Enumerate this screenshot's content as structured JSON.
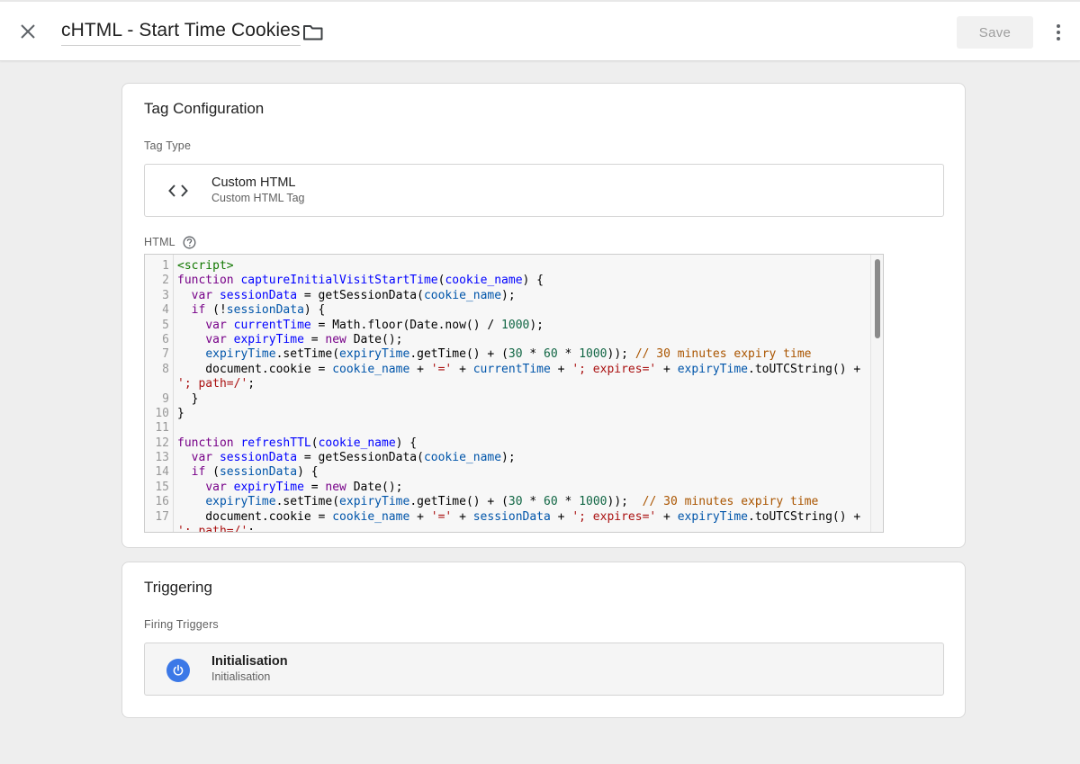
{
  "header": {
    "title": "cHTML - Start Time Cookies",
    "save_label": "Save"
  },
  "tag_configuration": {
    "title": "Tag Configuration",
    "tag_type_label": "Tag Type",
    "tag_type": {
      "name": "Custom HTML",
      "description": "Custom HTML Tag"
    },
    "html_label": "HTML"
  },
  "triggering": {
    "title": "Triggering",
    "firing_triggers_label": "Firing Triggers",
    "trigger": {
      "name": "Initialisation",
      "type": "Initialisation"
    }
  },
  "editor": {
    "lines": [
      {
        "n": "1",
        "tokens": [
          [
            "tag",
            "<script>"
          ]
        ]
      },
      {
        "n": "2",
        "tokens": [
          [
            "kw",
            "function"
          ],
          [
            "",
            " "
          ],
          [
            "def",
            "captureInitialVisitStartTime"
          ],
          [
            "",
            "("
          ],
          [
            "def",
            "cookie_name"
          ],
          [
            "",
            ") {"
          ]
        ]
      },
      {
        "n": "3",
        "tokens": [
          [
            "",
            "  "
          ],
          [
            "kw",
            "var"
          ],
          [
            "",
            " "
          ],
          [
            "def",
            "sessionData"
          ],
          [
            "",
            " = getSessionData("
          ],
          [
            "var",
            "cookie_name"
          ],
          [
            "",
            ");"
          ]
        ]
      },
      {
        "n": "4",
        "tokens": [
          [
            "",
            "  "
          ],
          [
            "kw",
            "if"
          ],
          [
            "",
            " (!"
          ],
          [
            "var",
            "sessionData"
          ],
          [
            "",
            ") {"
          ]
        ]
      },
      {
        "n": "5",
        "tokens": [
          [
            "",
            "    "
          ],
          [
            "kw",
            "var"
          ],
          [
            "",
            " "
          ],
          [
            "def",
            "currentTime"
          ],
          [
            "",
            " = Math.floor(Date.now() / "
          ],
          [
            "num",
            "1000"
          ],
          [
            "",
            ");"
          ]
        ]
      },
      {
        "n": "6",
        "tokens": [
          [
            "",
            "    "
          ],
          [
            "kw",
            "var"
          ],
          [
            "",
            " "
          ],
          [
            "def",
            "expiryTime"
          ],
          [
            "",
            " = "
          ],
          [
            "kw",
            "new"
          ],
          [
            "",
            " Date();"
          ]
        ]
      },
      {
        "n": "7",
        "tokens": [
          [
            "",
            "    "
          ],
          [
            "var",
            "expiryTime"
          ],
          [
            "",
            ".setTime("
          ],
          [
            "var",
            "expiryTime"
          ],
          [
            "",
            ".getTime() + ("
          ],
          [
            "num",
            "30"
          ],
          [
            "",
            " * "
          ],
          [
            "num",
            "60"
          ],
          [
            "",
            " * "
          ],
          [
            "num",
            "1000"
          ],
          [
            "",
            ")); "
          ],
          [
            "cmt",
            "// 30 minutes expiry time"
          ]
        ]
      },
      {
        "n": "8",
        "tokens": [
          [
            "",
            "    document.cookie = "
          ],
          [
            "var",
            "cookie_name"
          ],
          [
            "",
            " + "
          ],
          [
            "str",
            "'='"
          ],
          [
            "",
            " + "
          ],
          [
            "var",
            "currentTime"
          ],
          [
            "",
            " + "
          ],
          [
            "str",
            "'; expires='"
          ],
          [
            "",
            " + "
          ],
          [
            "var",
            "expiryTime"
          ],
          [
            "",
            ".toUTCString() +"
          ]
        ]
      },
      {
        "n": "",
        "tokens": [
          [
            "str",
            "'; path=/'"
          ],
          [
            "",
            ";"
          ]
        ]
      },
      {
        "n": "9",
        "tokens": [
          [
            "",
            "  }"
          ]
        ]
      },
      {
        "n": "10",
        "tokens": [
          [
            "",
            "}"
          ]
        ]
      },
      {
        "n": "11",
        "tokens": []
      },
      {
        "n": "12",
        "tokens": [
          [
            "kw",
            "function"
          ],
          [
            "",
            " "
          ],
          [
            "def",
            "refreshTTL"
          ],
          [
            "",
            "("
          ],
          [
            "def",
            "cookie_name"
          ],
          [
            "",
            ") {"
          ]
        ]
      },
      {
        "n": "13",
        "tokens": [
          [
            "",
            "  "
          ],
          [
            "kw",
            "var"
          ],
          [
            "",
            " "
          ],
          [
            "def",
            "sessionData"
          ],
          [
            "",
            " = getSessionData("
          ],
          [
            "var",
            "cookie_name"
          ],
          [
            "",
            ");"
          ]
        ]
      },
      {
        "n": "14",
        "tokens": [
          [
            "",
            "  "
          ],
          [
            "kw",
            "if"
          ],
          [
            "",
            " ("
          ],
          [
            "var",
            "sessionData"
          ],
          [
            "",
            ") {"
          ]
        ]
      },
      {
        "n": "15",
        "tokens": [
          [
            "",
            "    "
          ],
          [
            "kw",
            "var"
          ],
          [
            "",
            " "
          ],
          [
            "def",
            "expiryTime"
          ],
          [
            "",
            " = "
          ],
          [
            "kw",
            "new"
          ],
          [
            "",
            " Date();"
          ]
        ]
      },
      {
        "n": "16",
        "tokens": [
          [
            "",
            "    "
          ],
          [
            "var",
            "expiryTime"
          ],
          [
            "",
            ".setTime("
          ],
          [
            "var",
            "expiryTime"
          ],
          [
            "",
            ".getTime() + ("
          ],
          [
            "num",
            "30"
          ],
          [
            "",
            " * "
          ],
          [
            "num",
            "60"
          ],
          [
            "",
            " * "
          ],
          [
            "num",
            "1000"
          ],
          [
            "",
            "));  "
          ],
          [
            "cmt",
            "// 30 minutes expiry time"
          ]
        ]
      },
      {
        "n": "17",
        "tokens": [
          [
            "",
            "    document.cookie = "
          ],
          [
            "var",
            "cookie_name"
          ],
          [
            "",
            " + "
          ],
          [
            "str",
            "'='"
          ],
          [
            "",
            " + "
          ],
          [
            "var",
            "sessionData"
          ],
          [
            "",
            " + "
          ],
          [
            "str",
            "'; expires='"
          ],
          [
            "",
            " + "
          ],
          [
            "var",
            "expiryTime"
          ],
          [
            "",
            ".toUTCString() +"
          ]
        ]
      },
      {
        "n": "",
        "tokens": [
          [
            "str",
            "'; path=/'"
          ],
          [
            "",
            ";"
          ]
        ]
      }
    ]
  },
  "icons": {
    "close": "close-icon",
    "folder": "folder-icon",
    "more": "more-vert-icon",
    "code": "code-brackets-icon",
    "help": "help-circle-icon",
    "power": "power-icon"
  },
  "colors": {
    "accent": "#3b78e7",
    "background": "#eeeeee",
    "card": "#ffffff"
  }
}
